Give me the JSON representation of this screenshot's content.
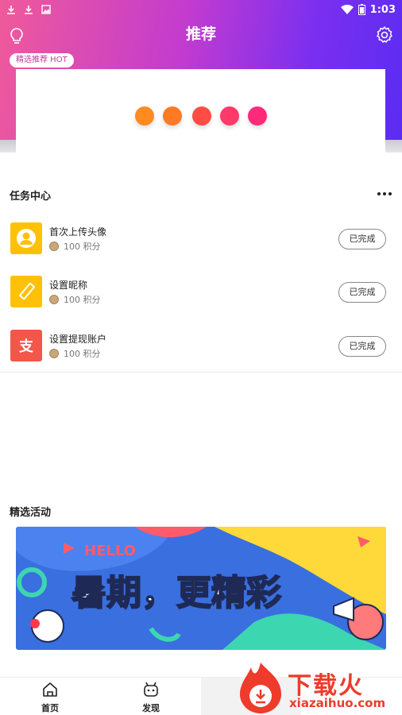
{
  "status": {
    "time": "1:03"
  },
  "header": {
    "title": "推荐",
    "hot_tag": "精选推荐 HOT"
  },
  "tasks": {
    "title": "任务中心",
    "items": [
      {
        "name": "首次上传头像",
        "points": "100 积分",
        "status": "已完成",
        "icon": "avatar-icon",
        "color": "#ffc107"
      },
      {
        "name": "设置昵称",
        "points": "100 积分",
        "status": "已完成",
        "icon": "pencil-icon",
        "color": "#ffc107"
      },
      {
        "name": "设置提现账户",
        "points": "100 积分",
        "status": "已完成",
        "icon": "alipay-icon",
        "color": "#f4564a"
      }
    ]
  },
  "activities": {
    "title": "精选活动",
    "banner": {
      "hello": "HELLO",
      "headline": "暑期，更精彩"
    }
  },
  "tabbar": {
    "items": [
      {
        "label": "首页",
        "icon": "home-icon"
      },
      {
        "label": "发现",
        "icon": "discover-icon"
      }
    ]
  },
  "watermark": {
    "brand": "下载火",
    "domain": "xiazaihuo.com"
  },
  "colors": {
    "gradient_start": "#f05a9a",
    "gradient_end": "#5a2cf2",
    "dot_colors": [
      "#ff8a1f",
      "#ff7a25",
      "#ff4c45",
      "#ff3a6a",
      "#ff2a7a"
    ]
  }
}
